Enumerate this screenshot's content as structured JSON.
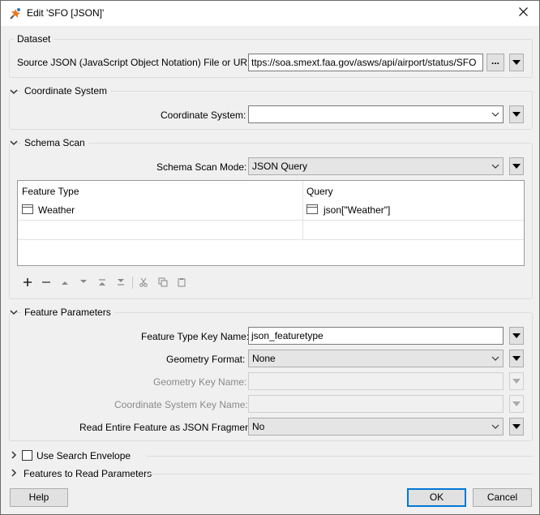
{
  "window": {
    "title": "Edit 'SFO [JSON]'"
  },
  "dataset": {
    "group_label": "Dataset",
    "source_label": "Source JSON (JavaScript Object Notation) File or URL:",
    "source_value": "ttps://soa.smext.faa.gov/asws/api/airport/status/SFO",
    "browse_label": "..."
  },
  "coordinate_system": {
    "group_label": "Coordinate System",
    "field_label": "Coordinate System:",
    "value": ""
  },
  "schema_scan": {
    "group_label": "Schema Scan",
    "mode_label": "Schema Scan Mode:",
    "mode_value": "JSON Query",
    "table": {
      "columns": [
        "Feature Type",
        "Query"
      ],
      "rows": [
        {
          "feature_type": "Weather",
          "query": "json[\"Weather\"]"
        }
      ]
    }
  },
  "feature_parameters": {
    "group_label": "Feature Parameters",
    "type_key_label": "Feature Type Key Name:",
    "type_key_value": "json_featuretype",
    "geometry_format_label": "Geometry Format:",
    "geometry_format_value": "None",
    "geometry_key_label": "Geometry Key Name:",
    "geometry_key_value": "",
    "coord_key_label": "Coordinate System Key Name:",
    "coord_key_value": "",
    "read_fragment_label": "Read Entire Feature as JSON Fragment:",
    "read_fragment_value": "No"
  },
  "search_envelope": {
    "label": "Use Search Envelope",
    "checked": false
  },
  "features_to_read": {
    "label": "Features to Read Parameters"
  },
  "buttons": {
    "help": "Help",
    "ok": "OK",
    "cancel": "Cancel"
  },
  "icons": {
    "app": "fme-workbench-icon",
    "close": "close-icon"
  }
}
